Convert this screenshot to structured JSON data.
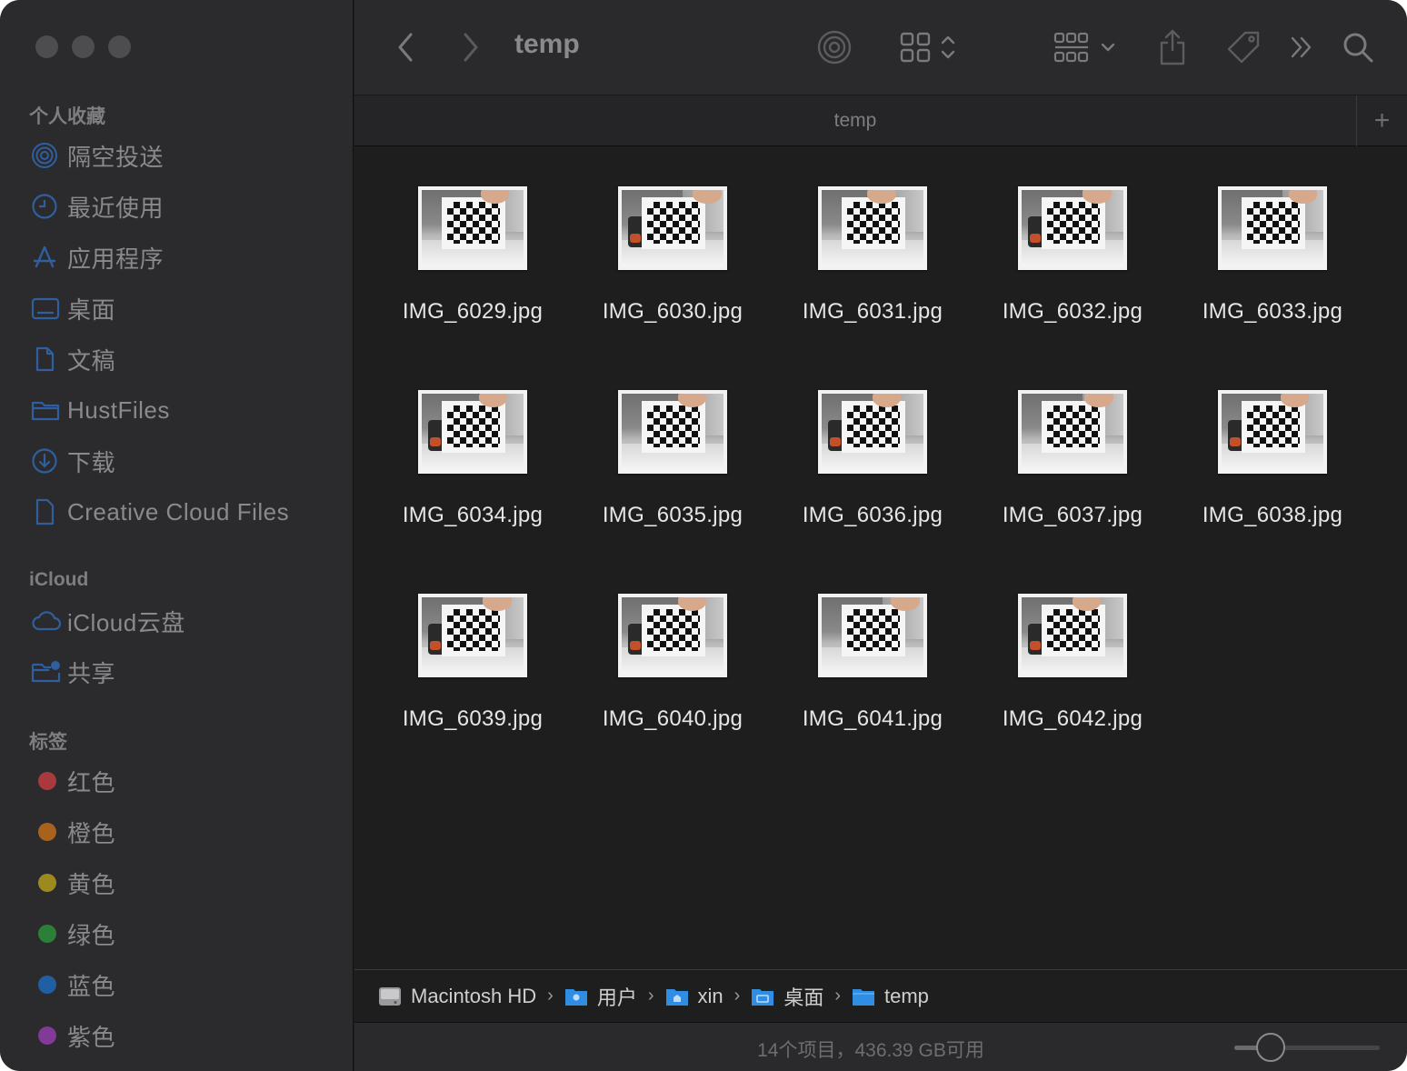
{
  "window": {
    "title": "temp"
  },
  "sidebar": {
    "favorites_title": "个人收藏",
    "favorites": [
      {
        "label": "隔空投送",
        "icon": "airdrop-icon"
      },
      {
        "label": "最近使用",
        "icon": "clock-icon"
      },
      {
        "label": "应用程序",
        "icon": "applications-icon"
      },
      {
        "label": "桌面",
        "icon": "desktop-icon"
      },
      {
        "label": "文稿",
        "icon": "document-icon"
      },
      {
        "label": "HustFiles",
        "icon": "folder-icon"
      },
      {
        "label": "下载",
        "icon": "download-icon"
      },
      {
        "label": "Creative Cloud Files",
        "icon": "file-icon"
      }
    ],
    "icloud_title": "iCloud",
    "icloud": [
      {
        "label": "iCloud云盘",
        "icon": "cloud-icon"
      },
      {
        "label": "共享",
        "icon": "shared-folder-icon"
      }
    ],
    "tags_title": "标签",
    "tags": [
      {
        "label": "红色",
        "color": "#b33b3b"
      },
      {
        "label": "橙色",
        "color": "#b5661f"
      },
      {
        "label": "黄色",
        "color": "#a89423"
      },
      {
        "label": "绿色",
        "color": "#2f8a3a"
      },
      {
        "label": "蓝色",
        "color": "#2368b0"
      },
      {
        "label": "紫色",
        "color": "#8a3fa3"
      }
    ]
  },
  "toolbar": {
    "title": "temp",
    "buttons": [
      "back-icon",
      "forward-icon",
      "airdrop-icon",
      "icon-view-icon",
      "group-icon",
      "share-icon",
      "tag-icon",
      "more-icon",
      "search-icon"
    ]
  },
  "tab": {
    "label": "temp",
    "add": "+"
  },
  "files": [
    {
      "name": "IMG_6029.jpg"
    },
    {
      "name": "IMG_6030.jpg"
    },
    {
      "name": "IMG_6031.jpg"
    },
    {
      "name": "IMG_6032.jpg"
    },
    {
      "name": "IMG_6033.jpg"
    },
    {
      "name": "IMG_6034.jpg"
    },
    {
      "name": "IMG_6035.jpg"
    },
    {
      "name": "IMG_6036.jpg"
    },
    {
      "name": "IMG_6037.jpg"
    },
    {
      "name": "IMG_6038.jpg"
    },
    {
      "name": "IMG_6039.jpg"
    },
    {
      "name": "IMG_6040.jpg"
    },
    {
      "name": "IMG_6041.jpg"
    },
    {
      "name": "IMG_6042.jpg"
    }
  ],
  "path": [
    {
      "label": "Macintosh HD",
      "icon": "hard-drive-icon"
    },
    {
      "label": "用户",
      "icon": "users-folder-icon"
    },
    {
      "label": "xin",
      "icon": "home-folder-icon"
    },
    {
      "label": "桌面",
      "icon": "desktop-folder-icon"
    },
    {
      "label": "temp",
      "icon": "folder-icon"
    }
  ],
  "status": {
    "text": "14个项目，436.39 GB可用",
    "zoom_level": 0.25
  }
}
